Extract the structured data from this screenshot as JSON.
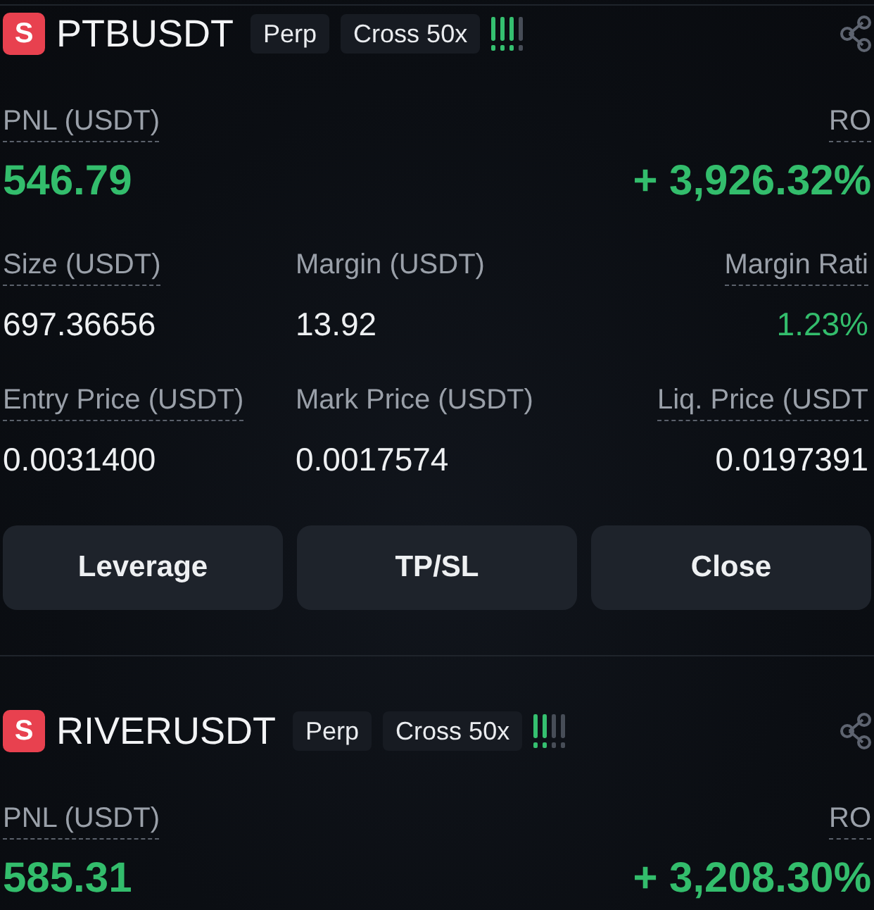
{
  "positions": [
    {
      "logo_letter": "S",
      "symbol": "PTBUSDT",
      "tags": [
        "Perp",
        "Cross 50x"
      ],
      "risk_bars": [
        {
          "lit": true
        },
        {
          "lit": true
        },
        {
          "lit": true
        },
        {
          "lit": false
        }
      ],
      "pnl": {
        "label": "PNL (USDT)",
        "value": "546.79"
      },
      "roi": {
        "label": "RO",
        "value": "+ 3,926.32%"
      },
      "details": [
        {
          "label": "Size (USDT)",
          "value": "697.36656",
          "tooltip": true,
          "kind": "plain"
        },
        {
          "label": "Margin (USDT)",
          "value": "13.92",
          "tooltip": false,
          "kind": "plain"
        },
        {
          "label": "Margin Rati",
          "value": "1.23%",
          "tooltip": true,
          "kind": "gain"
        },
        {
          "label": "Entry Price (USDT)",
          "value": "0.0031400",
          "tooltip": true,
          "kind": "plain"
        },
        {
          "label": "Mark Price (USDT)",
          "value": "0.0017574",
          "tooltip": false,
          "kind": "plain"
        },
        {
          "label": "Liq. Price (USDT",
          "value": "0.0197391",
          "tooltip": true,
          "kind": "plain"
        }
      ],
      "buttons": [
        "Leverage",
        "TP/SL",
        "Close"
      ]
    },
    {
      "logo_letter": "S",
      "symbol": "RIVERUSDT",
      "tags": [
        "Perp",
        "Cross 50x"
      ],
      "risk_bars": [
        {
          "lit": true
        },
        {
          "lit": true
        },
        {
          "lit": false
        },
        {
          "lit": false
        }
      ],
      "pnl": {
        "label": "PNL (USDT)",
        "value": "585.31"
      },
      "roi": {
        "label": "RO",
        "value": "+ 3,208.30%"
      }
    }
  ]
}
